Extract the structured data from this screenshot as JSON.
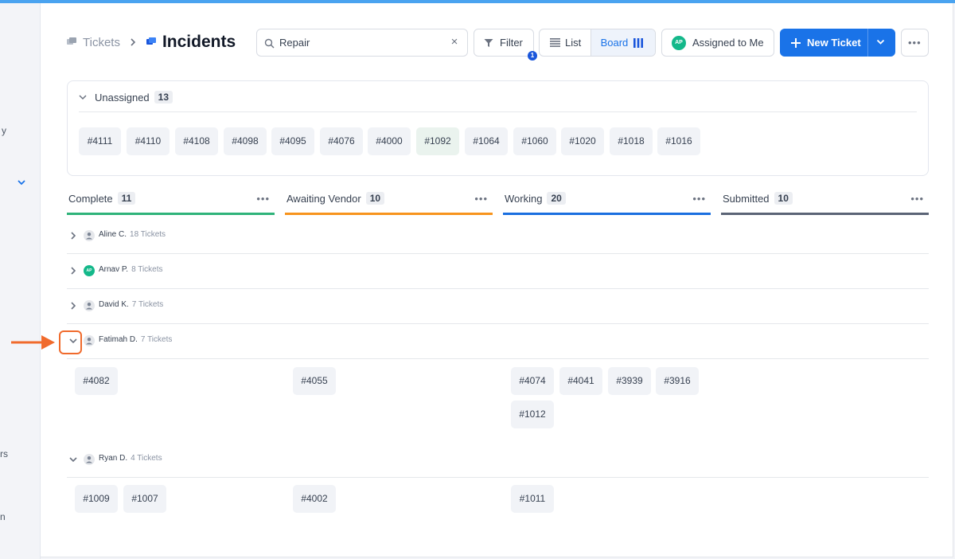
{
  "sidebar": {
    "fragments": [
      "y",
      "rs",
      "n"
    ]
  },
  "breadcrumb": {
    "parent": "Tickets",
    "current": "Incidents"
  },
  "search": {
    "value": "Repair",
    "clear_glyph": "×"
  },
  "toolbar": {
    "filter_label": "Filter",
    "filter_badge": "1",
    "view_list": "List",
    "view_board": "Board",
    "assigned_initials": "AP",
    "assigned_label": "Assigned to Me",
    "new_ticket": "New Ticket",
    "more_glyph": "•••"
  },
  "unassigned": {
    "label": "Unassigned",
    "count": "13",
    "tickets": [
      "#4111",
      "#4110",
      "#4108",
      "#4098",
      "#4095",
      "#4076",
      "#4000",
      "#1092",
      "#1064",
      "#1060",
      "#1020",
      "#1018",
      "#1016"
    ]
  },
  "columns": [
    {
      "label": "Complete",
      "count": "11",
      "color": "#2fb37a"
    },
    {
      "label": "Awaiting Vendor",
      "count": "10",
      "color": "#f7941d"
    },
    {
      "label": "Working",
      "count": "20",
      "color": "#1a6fe0"
    },
    {
      "label": "Submitted",
      "count": "10",
      "color": "#5b6476"
    }
  ],
  "groups": [
    {
      "name": "Aline C.",
      "count": "18 Tickets",
      "expanded": false
    },
    {
      "name": "Arnav P.",
      "count": "8 Tickets",
      "expanded": false,
      "initials": "AP"
    },
    {
      "name": "David K.",
      "count": "7 Tickets",
      "expanded": false
    },
    {
      "name": "Fatimah D.",
      "count": "7 Tickets",
      "expanded": true,
      "tickets": {
        "complete": [
          "#4082"
        ],
        "awaiting": [
          "#4055"
        ],
        "working": [
          "#4074",
          "#4041",
          "#3939",
          "#3916",
          "#1012"
        ]
      }
    },
    {
      "name": "Ryan D.",
      "count": "4 Tickets",
      "expanded": true,
      "tickets": {
        "complete": [
          "#1009",
          "#1007"
        ],
        "awaiting": [
          "#4002"
        ],
        "working": [
          "#1011"
        ]
      }
    }
  ],
  "colors": {
    "accent": "#1a73e8",
    "annotation": "#f06a2c"
  }
}
